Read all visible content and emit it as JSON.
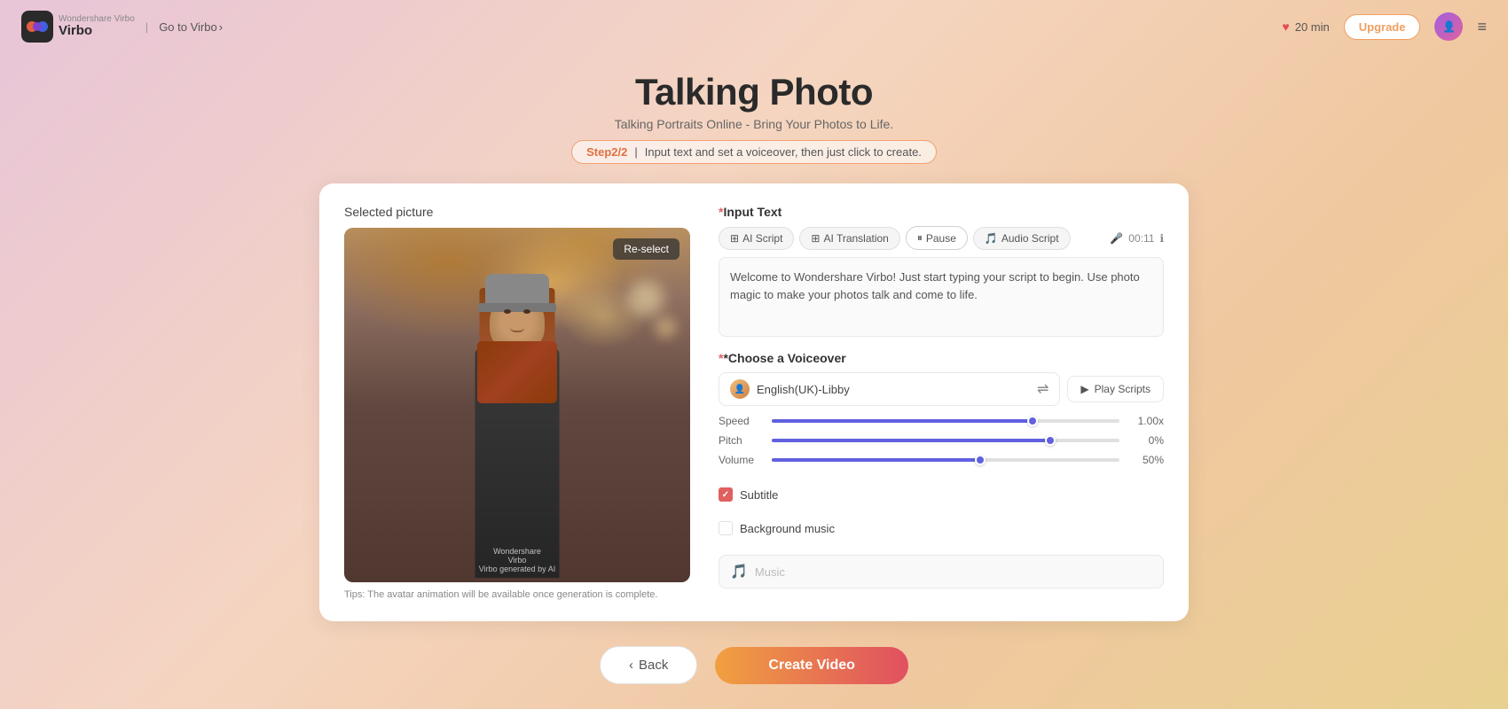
{
  "header": {
    "logo_text": "Wondershare\nVirbo",
    "goto_virbo": "Go to Virbo",
    "goto_arrow": "›",
    "separator": "|",
    "credits_amount": "20 min",
    "upgrade_label": "Upgrade",
    "menu_icon": "≡"
  },
  "hero": {
    "title": "Talking Photo",
    "subtitle": "Talking Portraits Online - Bring Your Photos to Life.",
    "step_label": "Step2/2",
    "step_separator": "|",
    "step_description": "Input text and set a voiceover, then just click to create."
  },
  "left_panel": {
    "section_label": "Selected picture",
    "reselect_btn": "Re-select",
    "watermark_line1": "Wondershare",
    "watermark_line2": "Virbo",
    "watermark_line3": "Virbo generated by AI",
    "tips_text": "Tips: The avatar animation will be available once generation is complete."
  },
  "right_panel": {
    "input_text_label": "*Input Text",
    "input_text_required": "*",
    "input_text_section": "Input Text",
    "tabs": [
      {
        "id": "ai_script",
        "label": "AI Script",
        "icon": "⊞"
      },
      {
        "id": "ai_translation",
        "label": "AI Translation",
        "icon": "⊞"
      },
      {
        "id": "pause",
        "label": "Pause",
        "icon": "⏸"
      },
      {
        "id": "audio_script",
        "label": "Audio Script",
        "icon": "🎵"
      }
    ],
    "duration": "00:11",
    "text_content": "Welcome to Wondershare Virbo! Just start typing your script to begin. Use photo magic to make your photos talk and come to life.",
    "voiceover_label": "*Choose a Voiceover",
    "voiceover_required": "*",
    "voice_name": "English(UK)-Libby",
    "play_scripts_label": "Play Scripts",
    "sliders": [
      {
        "id": "speed",
        "label": "Speed",
        "fill_percent": 75,
        "value": "1.00x"
      },
      {
        "id": "pitch",
        "label": "Pitch",
        "fill_percent": 80,
        "value": "0%"
      },
      {
        "id": "volume",
        "label": "Volume",
        "fill_percent": 60,
        "value": "50%"
      }
    ],
    "subtitle_label": "Subtitle",
    "subtitle_checked": true,
    "background_music_label": "Background music",
    "background_music_checked": false,
    "music_placeholder": "Music"
  },
  "bottom": {
    "back_label": "< Back",
    "back_arrow": "‹",
    "create_label": "Create Video"
  }
}
